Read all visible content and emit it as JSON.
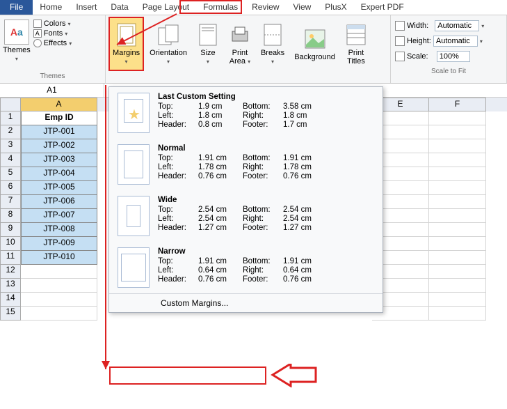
{
  "tabs": {
    "file": "File",
    "home": "Home",
    "insert": "Insert",
    "data": "Data",
    "pagelayout": "Page Layout",
    "formulas": "Formulas",
    "review": "Review",
    "view": "View",
    "plusx": "PlusX",
    "expertpdf": "Expert PDF"
  },
  "themes": {
    "btn": "Themes",
    "colors": "Colors",
    "fonts": "Fonts",
    "effects": "Effects",
    "group": "Themes"
  },
  "pagesetup": {
    "margins": "Margins",
    "orientation": "Orientation",
    "size": "Size",
    "printarea": "Print\nArea",
    "breaks": "Breaks",
    "background": "Background",
    "printtitles": "Print\nTitles"
  },
  "scale": {
    "width": "Width:",
    "height": "Height:",
    "scale": "Scale:",
    "auto": "Automatic",
    "pct": "100%",
    "group": "Scale to Fit"
  },
  "namebox": "A1",
  "columns": [
    "A",
    "E",
    "F"
  ],
  "datacol_header": "Emp ID",
  "data": [
    "JTP-001",
    "JTP-002",
    "JTP-003",
    "JTP-004",
    "JTP-005",
    "JTP-006",
    "JTP-007",
    "JTP-008",
    "JTP-009",
    "JTP-010"
  ],
  "dropdown": {
    "last": {
      "title": "Last Custom Setting",
      "top": "1.9 cm",
      "bottom": "3.58 cm",
      "left": "1.8 cm",
      "right": "1.8 cm",
      "header": "0.8 cm",
      "footer": "1.7 cm"
    },
    "normal": {
      "title": "Normal",
      "top": "1.91 cm",
      "bottom": "1.91 cm",
      "left": "1.78 cm",
      "right": "1.78 cm",
      "header": "0.76 cm",
      "footer": "0.76 cm"
    },
    "wide": {
      "title": "Wide",
      "top": "2.54 cm",
      "bottom": "2.54 cm",
      "left": "2.54 cm",
      "right": "2.54 cm",
      "header": "1.27 cm",
      "footer": "1.27 cm"
    },
    "narrow": {
      "title": "Narrow",
      "top": "1.91 cm",
      "bottom": "1.91 cm",
      "left": "0.64 cm",
      "right": "0.64 cm",
      "header": "0.76 cm",
      "footer": "0.76 cm"
    },
    "labels": {
      "top": "Top:",
      "bottom": "Bottom:",
      "left": "Left:",
      "right": "Right:",
      "header": "Header:",
      "footer": "Footer:"
    },
    "custom": "Custom Margins..."
  }
}
